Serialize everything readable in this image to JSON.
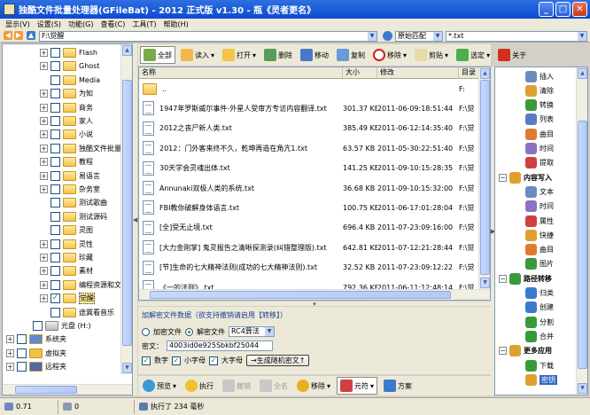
{
  "window": {
    "title": "独酷文件批量处理器(GFileBat) - 2012 正式版 v1.30 - 瓶《灵者更名》"
  },
  "menu": [
    "显示(V)",
    "设置(S)",
    "功能(G)",
    "查看(C)",
    "工具(T)",
    "帮助(H)"
  ],
  "address": {
    "path": "F:\\觉醒",
    "match_mode": "原始匹配",
    "filter": "*.txt"
  },
  "tree": [
    {
      "label": "Flash",
      "indent": 1,
      "expand": "+",
      "checked": false
    },
    {
      "label": "Ghost",
      "indent": 1,
      "expand": "+",
      "checked": false
    },
    {
      "label": "Media",
      "indent": 1,
      "expand": "",
      "checked": false
    },
    {
      "label": "为知",
      "indent": 1,
      "expand": "+",
      "checked": false
    },
    {
      "label": "商务",
      "indent": 1,
      "expand": "+",
      "checked": false
    },
    {
      "label": "家人",
      "indent": 1,
      "expand": "+",
      "checked": false
    },
    {
      "label": "小说",
      "indent": 1,
      "expand": "+",
      "checked": false
    },
    {
      "label": "独酷文件批量",
      "indent": 1,
      "expand": "+",
      "checked": false
    },
    {
      "label": "教程",
      "indent": 1,
      "expand": "+",
      "checked": false
    },
    {
      "label": "易语言",
      "indent": 1,
      "expand": "+",
      "checked": false
    },
    {
      "label": "杂务室",
      "indent": 1,
      "expand": "+",
      "checked": false
    },
    {
      "label": "测试歌曲",
      "indent": 1,
      "expand": "",
      "checked": false
    },
    {
      "label": "测试源码",
      "indent": 1,
      "expand": "",
      "checked": false
    },
    {
      "label": "灵图",
      "indent": 1,
      "expand": "",
      "checked": false
    },
    {
      "label": "灵性",
      "indent": 1,
      "expand": "+",
      "checked": false
    },
    {
      "label": "珍藏",
      "indent": 1,
      "expand": "+",
      "checked": false
    },
    {
      "label": "素材",
      "indent": 1,
      "expand": "+",
      "checked": false
    },
    {
      "label": "编程资源和文",
      "indent": 1,
      "expand": "+",
      "checked": false
    },
    {
      "label": "觉醒",
      "indent": 1,
      "expand": "+",
      "checked": true
    },
    {
      "label": "途冀看音乐",
      "indent": 1,
      "expand": "",
      "checked": false
    },
    {
      "label": "光盘 (H:)",
      "indent": 0,
      "expand": "",
      "checked": false
    },
    {
      "label": "系统夹",
      "indent": -1,
      "expand": "+",
      "checked": false
    },
    {
      "label": "虚拟夹",
      "indent": -1,
      "expand": "+",
      "checked": false
    },
    {
      "label": "远程夹",
      "indent": -1,
      "expand": "+",
      "checked": false
    }
  ],
  "toolbar": [
    "全部",
    "读入",
    "打开",
    "删除",
    "移动",
    "复制",
    "移除",
    "剪贴",
    "选定",
    "关于"
  ],
  "filelist": {
    "columns": [
      "名称",
      "大小",
      "修改",
      "目录"
    ],
    "rows": [
      {
        "name": "..",
        "size": "",
        "date": "",
        "dir": "F:"
      },
      {
        "name": "1947年罗斯威尔事件-外星人受审方专访内容翻译.txt",
        "size": "301.37 KB",
        "date": "2011-06-09:18:51:44",
        "dir": "F:\\觉"
      },
      {
        "name": "2012之丧尸新人类.txt",
        "size": "385.49 KB",
        "date": "2011-06-12:14:35:40",
        "dir": "F:\\觉"
      },
      {
        "name": "2012：门外客来终不久，乾坤再造在角亢1.txt",
        "size": "63.57 KB",
        "date": "2011-05-30:22:51:40",
        "dir": "F:\\觉"
      },
      {
        "name": "30天学会灵魂出体.txt",
        "size": "141.25 KB",
        "date": "2011-09-10:15:28:35",
        "dir": "F:\\觉"
      },
      {
        "name": "Annunaki双极人类的系统.txt",
        "size": "36.68 KB",
        "date": "2011-09-10:15:32:00",
        "dir": "F:\\觉"
      },
      {
        "name": "FBI教你破解身体语言.txt",
        "size": "100.75 KB",
        "date": "2011-06-17:01:28:04",
        "dir": "F:\\觉"
      },
      {
        "name": "[全]受无止境.txt",
        "size": "696.4 KB",
        "date": "2011-07-23:09:16:00",
        "dir": "F:\\觉"
      },
      {
        "name": "[大力金刚掌] 鬼灵报告之清晰探测录(纠错整理版).txt",
        "size": "642.81 KB",
        "date": "2011-07-12:21:28:44",
        "dir": "F:\\觉"
      },
      {
        "name": "[节]生命的七大精神法则(成功的七大精神法则).txt",
        "size": "32.52 KB",
        "date": "2011-07-23:09:12:22",
        "dir": "F:\\觉"
      },
      {
        "name": "《一的法则》.txt",
        "size": "792.36 KB",
        "date": "2011-06-11:12:48:14",
        "dir": "F:\\觉"
      }
    ]
  },
  "encrypt": {
    "title": "加解密文件数据（欲支持撤销请启用【转移】）",
    "opt_encrypt": "加密文件",
    "opt_decrypt": "解密文件",
    "algorithm": "RC4算法",
    "key_label": "密文：",
    "key_value": "4003id0e925Sbkbf25044",
    "chk_digits": "数字",
    "chk_lower": "小字母",
    "chk_upper": "大字母",
    "gen_button": "→生成随机密文↑"
  },
  "bottom_toolbar": [
    "预览",
    "执行",
    "撤销",
    "全名",
    "移除",
    "元符",
    "方案"
  ],
  "right_tree": [
    {
      "label": "插入",
      "level": 2,
      "color": "#6d8bc0"
    },
    {
      "label": "清除",
      "level": 2,
      "color": "#e0a030"
    },
    {
      "label": "转换",
      "level": 2,
      "color": "#3a9a3a"
    },
    {
      "label": "列表",
      "level": 2,
      "color": "#5b7bc4"
    },
    {
      "label": "曲目",
      "level": 2,
      "color": "#e07a30"
    },
    {
      "label": "时间",
      "level": 2,
      "color": "#8a72c4"
    },
    {
      "label": "提取",
      "level": 2,
      "color": "#d04040"
    },
    {
      "label": "内容写入",
      "level": 1,
      "color": "#e0a030"
    },
    {
      "label": "文本",
      "level": 2,
      "color": "#6d8bc0"
    },
    {
      "label": "时间",
      "level": 2,
      "color": "#8a72c4"
    },
    {
      "label": "属性",
      "level": 2,
      "color": "#d04040"
    },
    {
      "label": "快捷",
      "level": 2,
      "color": "#e0a030"
    },
    {
      "label": "曲目",
      "level": 2,
      "color": "#e07a30"
    },
    {
      "label": "图片",
      "level": 2,
      "color": "#3a9a3a"
    },
    {
      "label": "路径转移",
      "level": 1,
      "color": "#3a9a3a"
    },
    {
      "label": "归类",
      "level": 2,
      "color": "#3a7ad0"
    },
    {
      "label": "创建",
      "level": 2,
      "color": "#3a7ad0"
    },
    {
      "label": "分割",
      "level": 2,
      "color": "#3a9a3a"
    },
    {
      "label": "合并",
      "level": 2,
      "color": "#3a9a3a"
    },
    {
      "label": "更多应用",
      "level": 1,
      "color": "#e0a030"
    },
    {
      "label": "下载",
      "level": 2,
      "color": "#3a9a3a"
    },
    {
      "label": "密钥",
      "level": 2,
      "color": "#e0a030",
      "selected": true
    }
  ],
  "status": {
    "left": "0.71",
    "count": "0",
    "message": "执行了 234 毫秒"
  }
}
